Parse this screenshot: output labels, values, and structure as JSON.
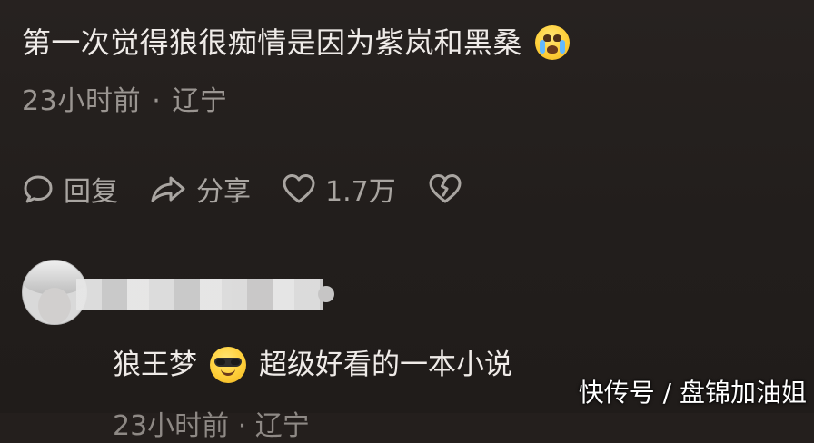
{
  "comment": {
    "text": "第一次觉得狼很痴情是因为紫岚和黑桑",
    "emoji": "loudly-crying-face",
    "time": "23小时前",
    "separator": "·",
    "location": "辽宁"
  },
  "actions": {
    "reply_label": "回复",
    "share_label": "分享",
    "like_count": "1.7万",
    "reply_icon": "speech-bubble-icon",
    "share_icon": "share-arrow-icon",
    "like_icon": "heart-icon",
    "dislike_icon": "broken-heart-icon"
  },
  "reply": {
    "text_part1": "狼王梦",
    "emoji": "smiling-face-with-sunglasses",
    "text_part2": "超级好看的一本小说",
    "meta_partial": "23小时前 · 辽宁"
  },
  "watermark": {
    "text": "快传号 / 盘锦加油姐"
  },
  "colors": {
    "background": "#241f1d",
    "primary_text": "#efebe8",
    "secondary_text": "#9a9591",
    "icon": "#a9a5a1"
  }
}
